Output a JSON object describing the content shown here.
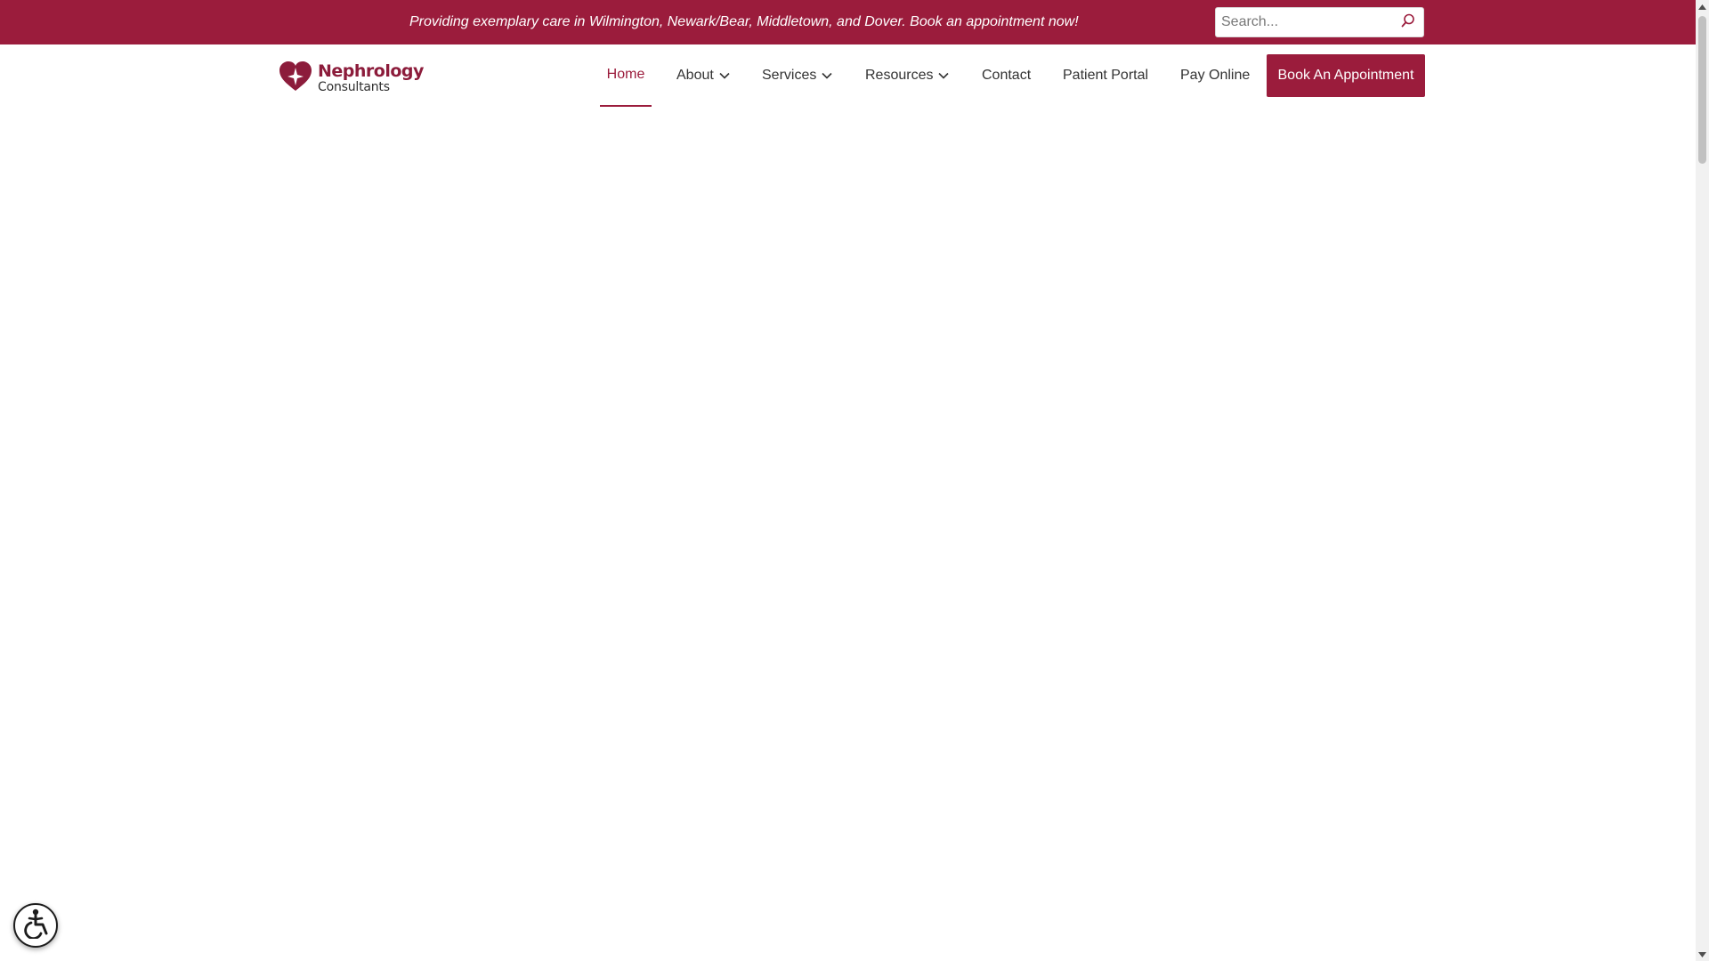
{
  "topbar": {
    "message": "Providing exemplary care in Wilmington, Newark/Bear, Middletown, and Dover. Book an appointment now!",
    "search": {
      "placeholder": "Search...",
      "value": "",
      "icon": "search-icon"
    }
  },
  "logo": {
    "title": "Nephrology",
    "subtitle": "Consultants",
    "icon": "heart-sparkle-icon"
  },
  "nav": {
    "items": [
      {
        "label": "Home",
        "active": true
      },
      {
        "label": "About",
        "dropdown": true
      },
      {
        "label": "Services",
        "dropdown": true
      },
      {
        "label": "Resources",
        "dropdown": true
      },
      {
        "label": "Contact"
      },
      {
        "label": "Patient Portal"
      },
      {
        "label": "Pay Online"
      }
    ],
    "cta": "Book An Appointment"
  },
  "accessibility": {
    "icon": "accessibility-icon"
  },
  "colors": {
    "brand": "#9b1c3c",
    "topbar_text": "#ffffff",
    "nav_text": "#333333"
  }
}
